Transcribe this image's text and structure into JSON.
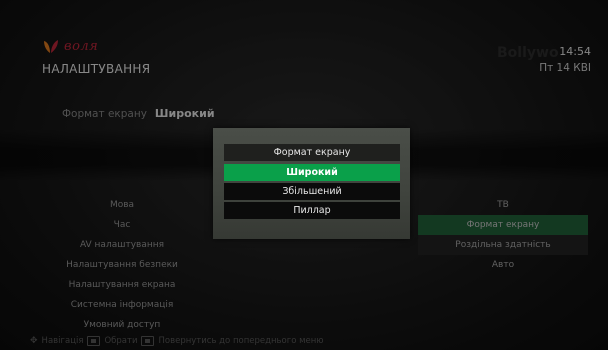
{
  "header": {
    "logo_text": "воля",
    "page_title": "НАЛАШТУВАННЯ",
    "brand_ghost": "Bollywo",
    "time": "14:54",
    "date": "Пт 14 КВІ"
  },
  "status": {
    "label": "Формат екрану",
    "value": "Широкий"
  },
  "left_menu": {
    "items": [
      {
        "label": "Мова"
      },
      {
        "label": "Час"
      },
      {
        "label": "AV налаштування"
      },
      {
        "label": "Налаштування безпеки"
      },
      {
        "label": "Налаштування екрана"
      },
      {
        "label": "Системна інформація"
      },
      {
        "label": "Умовний доступ"
      }
    ]
  },
  "right_panel": {
    "items": [
      {
        "label": "ТВ"
      },
      {
        "label": "Формат екрану"
      },
      {
        "label": "Роздільна здатність"
      },
      {
        "label": "Авто"
      }
    ]
  },
  "dialog": {
    "title": "Формат екрану",
    "options": [
      {
        "label": "Широкий",
        "selected": true
      },
      {
        "label": "Збільшений",
        "selected": false
      },
      {
        "label": "Пиллар",
        "selected": false
      }
    ]
  },
  "footer": {
    "navigation": "Навігація",
    "select": "Обрати",
    "back": "Повернутись до попереднього меню"
  },
  "colors": {
    "accent_green": "#0aa04a",
    "dark_green": "#21623a",
    "brand_red": "#c0263a",
    "brand_orange": "#e07a1f"
  }
}
